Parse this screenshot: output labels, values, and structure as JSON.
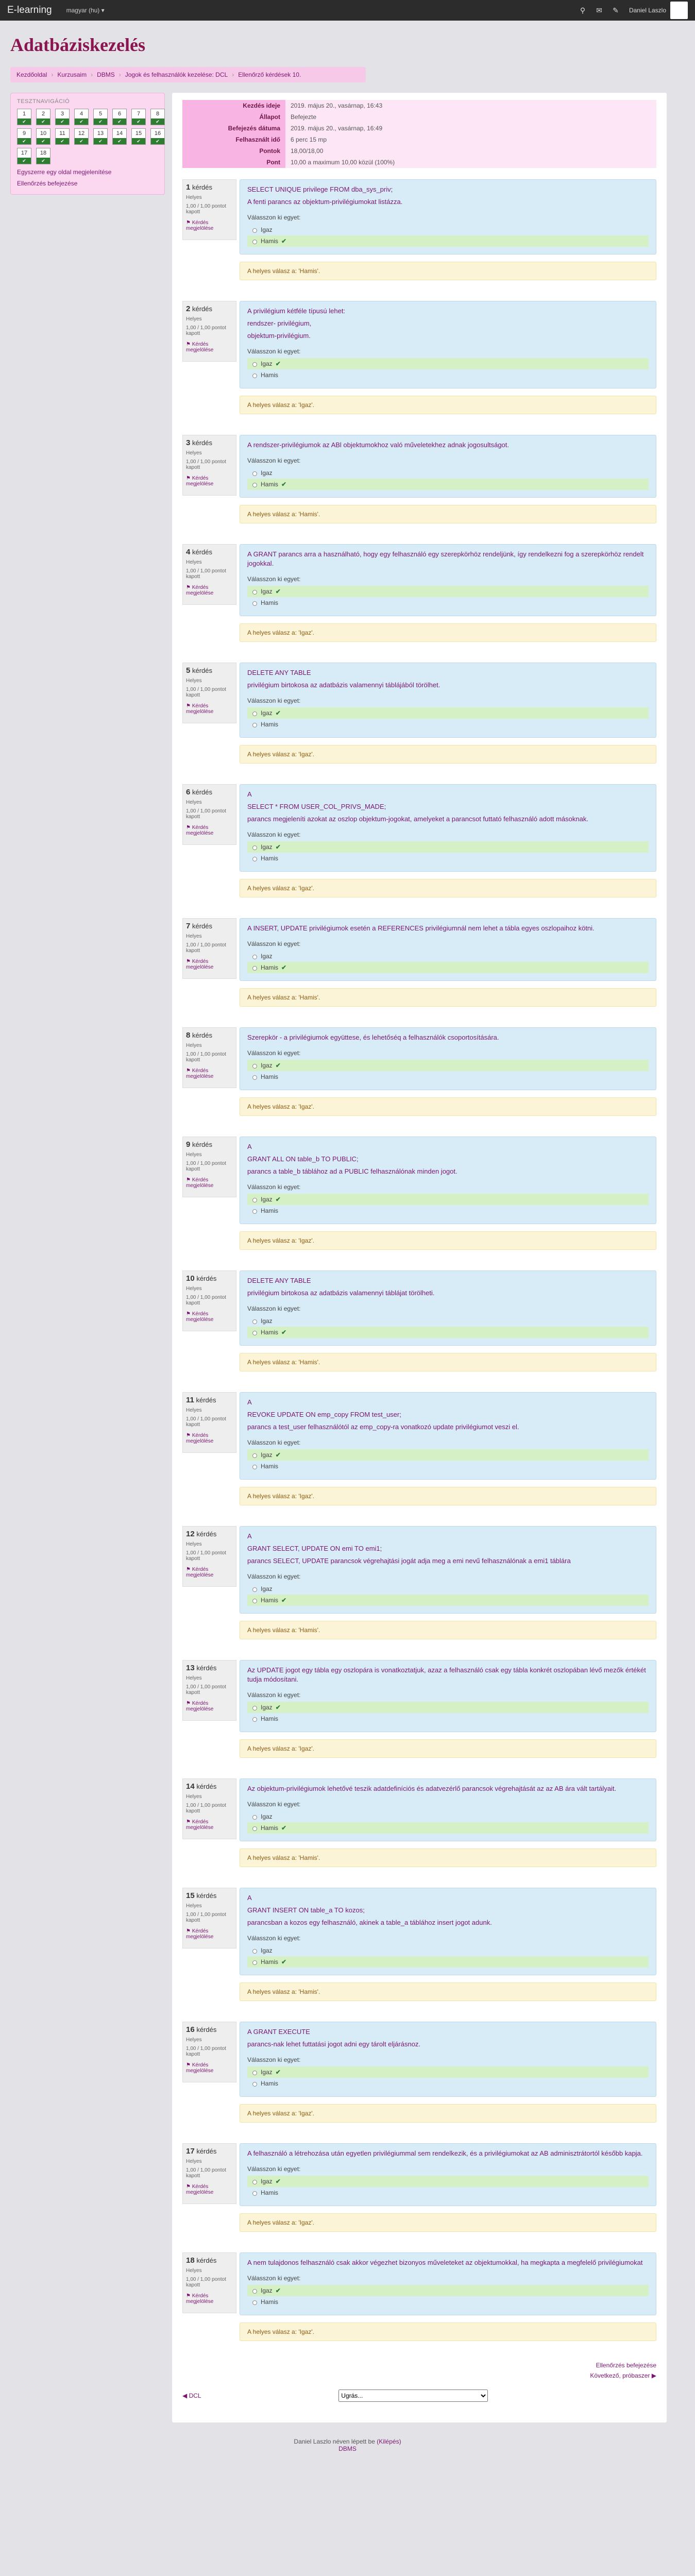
{
  "navbar": {
    "brand": "E-learning",
    "language": "magyar (hu) ▾",
    "user": "Daniel Laszlo"
  },
  "header": {
    "title": "Adatbáziskezelés"
  },
  "breadcrumb": [
    "Kezdőoldal",
    "Kurzusaim",
    "DBMS",
    "Jogok és felhasználók kezelése: DCL",
    "Ellenőrző kérdések 10."
  ],
  "nav_block": {
    "title": "TESZTNAVIGÁCIÓ",
    "question_numbers": [
      "1",
      "2",
      "3",
      "4",
      "5",
      "6",
      "7",
      "8",
      "9",
      "10",
      "11",
      "12",
      "13",
      "14",
      "15",
      "16",
      "17",
      "18"
    ],
    "finish_link": "Egyszerre egy oldal megjelenítése",
    "review_link": "Ellenőrzés befejezése"
  },
  "summary": {
    "rows": [
      {
        "label": "Kezdés ideje",
        "value": "2019. május 20., vasárnap, 16:43"
      },
      {
        "label": "Állapot",
        "value": "Befejezte"
      },
      {
        "label": "Befejezés dátuma",
        "value": "2019. május 20., vasárnap, 16:49"
      },
      {
        "label": "Felhasznált idő",
        "value": "6 perc 15 mp"
      },
      {
        "label": "Pontok",
        "value": "18,00/18,00"
      },
      {
        "label": "Pont",
        "value": "10,00 a maximum 10,00 közül (100%)"
      }
    ]
  },
  "question_info": {
    "status": "Helyes",
    "points": "1,00 / 1,00 pontot kapott",
    "flag": "Kérdés megjelölése",
    "label": "kérdés"
  },
  "answer_prompt": "Válasszon ki egyet:",
  "questions": [
    {
      "no": "1",
      "text": [
        "SELECT UNIQUE privilege FROM dba_sys_priv;",
        "A fenti parancs az objektum-privilégiumokat listázza."
      ],
      "options": [
        "Igaz",
        "Hamis"
      ],
      "correct": 1,
      "feedback": "A helyes válasz a: 'Hamis'."
    },
    {
      "no": "2",
      "text": [
        "A privilégium kétféle típusú lehet:",
        "rendszer- privilégium,",
        "objektum-privilégium."
      ],
      "options": [
        "Igaz",
        "Hamis"
      ],
      "correct": 0,
      "feedback": "A helyes válasz a: 'Igaz'."
    },
    {
      "no": "3",
      "text": [
        "A rendszer-privilégiumok az ABl objektumokhoz való  műveletekhez  adnak  jogosultságot."
      ],
      "options": [
        "Igaz",
        "Hamis"
      ],
      "correct": 1,
      "feedback": "A helyes válasz a: 'Hamis'."
    },
    {
      "no": "4",
      "text": [
        "A GRANT parancs arra a használható, hogy egy felhasználó egy szerepkörhöz rendeljünk, így rendelkezni fog a szerepkörhöz rendelt jogokkal."
      ],
      "options": [
        "Igaz",
        "Hamis"
      ],
      "correct": 0,
      "feedback": "A helyes válasz a: 'Igaz'."
    },
    {
      "no": "5",
      "text": [
        "DELETE ANY TABLE",
        "privilégium birtokosa az adatbázis valamennyi táblájából törölhet."
      ],
      "options": [
        "Igaz",
        "Hamis"
      ],
      "correct": 0,
      "feedback": "A helyes válasz a: 'Igaz'."
    },
    {
      "no": "6",
      "text": [
        "A",
        "SELECT * FROM USER_COL_PRIVS_MADE;",
        "parancs megjeleníti azokat az oszlop objektum-jogokat, amelyeket a parancsot futtató felhasználó adott másoknak."
      ],
      "options": [
        "Igaz",
        "Hamis"
      ],
      "correct": 0,
      "feedback": "A helyes válasz a: 'Igaz'."
    },
    {
      "no": "7",
      "text": [
        "A  INSERT,  UPDATE  privilégiumok esetén  a REFERENCES  privilégiumnál  nem lehet  a  tábla  egyes  oszlopaihoz kötni."
      ],
      "options": [
        "Igaz",
        "Hamis"
      ],
      "correct": 1,
      "feedback": "A helyes válasz a: 'Hamis'."
    },
    {
      "no": "8",
      "text": [
        "Szerepkör - a privilégiumok együttese, és lehetőséq a felhasználók csoportosítására."
      ],
      "options": [
        "Igaz",
        "Hamis"
      ],
      "correct": 0,
      "feedback": "A helyes válasz a: 'Igaz'."
    },
    {
      "no": "9",
      "text": [
        "A",
        "GRANT ALL ON table_b TO PUBLIC;",
        "parancs a table_b táblához ad a PUBLIC felhasználónak minden jogot."
      ],
      "options": [
        "Igaz",
        "Hamis"
      ],
      "correct": 0,
      "feedback": "A helyes válasz a: 'Igaz'."
    },
    {
      "no": "10",
      "text": [
        "DELETE ANY TABLE",
        "privilégium birtokosa az adatbázis valamennyi táblájat törölheti."
      ],
      "options": [
        "Igaz",
        "Hamis"
      ],
      "correct": 1,
      "feedback": "A helyes válasz a: 'Hamis'."
    },
    {
      "no": "11",
      "text": [
        "A",
        "REVOKE UPDATE ON emp_copy FROM test_user;",
        "parancs a test_user felhasználótól az emp_copy-ra vonatkozó update privilégiumot veszi el."
      ],
      "options": [
        "Igaz",
        "Hamis"
      ],
      "correct": 0,
      "feedback": "A helyes válasz a: 'Igaz'."
    },
    {
      "no": "12",
      "text": [
        "A",
        "GRANT SELECT, UPDATE ON emi TO emi1;",
        "parancs SELECT, UPDATE parancsok végrehajtási jogát adja meg a emi nevű felhasználónak a emi1 táblára"
      ],
      "options": [
        "Igaz",
        "Hamis"
      ],
      "correct": 1,
      "feedback": "A helyes válasz a: 'Hamis'."
    },
    {
      "no": "13",
      "text": [
        "Az UPDATE jogot egy tábla egy oszlopára is vonatkoztatjuk, azaz a felhasználó csak egy tábla konkrét oszlopában lévő mezők értékét tudja módosítani."
      ],
      "options": [
        "Igaz",
        "Hamis"
      ],
      "correct": 0,
      "feedback": "A helyes válasz a: 'Igaz'."
    },
    {
      "no": "14",
      "text": [
        "Az  objektum-privilégiumok  lehetővé  teszik  adatdefiníciós  és  adatvezérlő  parancsok végrehajtását  az az AB  ára vált tartályait."
      ],
      "options": [
        "Igaz",
        "Hamis"
      ],
      "correct": 1,
      "feedback": "A helyes válasz a: 'Hamis'."
    },
    {
      "no": "15",
      "text": [
        "A",
        "GRANT INSERT ON table_a TO kozos;",
        "parancsban a kozos egy felhasználó, akinek a table_a táblához insert jogot adunk."
      ],
      "options": [
        "Igaz",
        "Hamis"
      ],
      "correct": 1,
      "feedback": "A helyes válasz a: 'Hamis'."
    },
    {
      "no": "16",
      "text": [
        "A GRANT EXECUTE",
        "parancs-nak lehet futtatási jogot adni egy tárolt eljárásnoz."
      ],
      "options": [
        "Igaz",
        "Hamis"
      ],
      "correct": 0,
      "feedback": "A helyes válasz a: 'Igaz'."
    },
    {
      "no": "17",
      "text": [
        "A  felhasználó  a  létrehozása  után  egyetlen  privilégiummal sem rendelkezik, és a privilégiumokat az AB adminisztrátortól később kapja."
      ],
      "options": [
        "Igaz",
        "Hamis"
      ],
      "correct": 0,
      "feedback": "A helyes válasz a: 'Igaz'."
    },
    {
      "no": "18",
      "text": [
        "A  nem tulajdonos felhasználó  csak akkor végezhet bizonyos  műveleteket az objektumokkal,  ha  megkapta  a megfelelő privilégiumokat"
      ],
      "options": [
        "Igaz",
        "Hamis"
      ],
      "correct": 0,
      "feedback": "A helyes válasz a: 'Igaz'."
    }
  ],
  "bottom": {
    "finish_review": "Ellenőrzés befejezése",
    "next_link": "Következő, próbaszer ▶",
    "prev": "◀ DCL",
    "jump": "Ugrás..."
  },
  "footer": {
    "logged_in_as": "Daniel Laszlo néven lépett be",
    "logout": "(Kilépés)",
    "course": "DBMS"
  }
}
